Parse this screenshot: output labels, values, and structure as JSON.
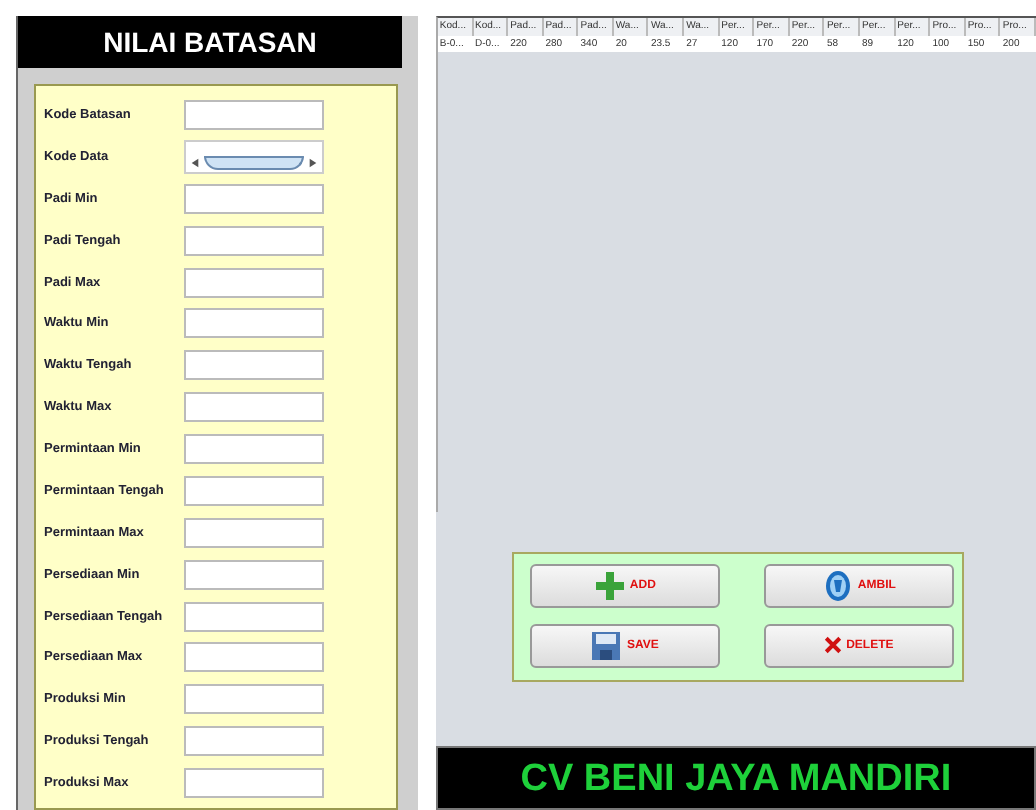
{
  "form": {
    "title": "NILAI BATASAN",
    "fields": [
      {
        "label": "Kode Batasan",
        "kind": "text"
      },
      {
        "label": "Kode Data",
        "kind": "scroll"
      },
      {
        "label": "Padi Min",
        "kind": "text"
      },
      {
        "label": "Padi Tengah",
        "kind": "text"
      },
      {
        "label": "Padi Max",
        "kind": "text"
      },
      {
        "label": "Waktu Min",
        "kind": "text"
      },
      {
        "label": "Waktu Tengah",
        "kind": "text"
      },
      {
        "label": "Waktu Max",
        "kind": "text"
      },
      {
        "label": "Permintaan Min",
        "kind": "text"
      },
      {
        "label": "Permintaan Tengah",
        "kind": "text"
      },
      {
        "label": "Permintaan Max",
        "kind": "text"
      },
      {
        "label": "Persediaan  Min",
        "kind": "text"
      },
      {
        "label": "Persediaan Tengah",
        "kind": "text"
      },
      {
        "label": "Persediaan Max",
        "kind": "text"
      },
      {
        "label": "Produksi Min",
        "kind": "text"
      },
      {
        "label": "Produksi Tengah",
        "kind": "text"
      },
      {
        "label": "Produksi Max",
        "kind": "text"
      }
    ]
  },
  "table": {
    "columns": [
      "Kod...",
      "Kod...",
      "Pad...",
      "Pad...",
      "Pad...",
      "Wa...",
      "Wa...",
      "Wa...",
      "Per...",
      "Per...",
      "Per...",
      "Per...",
      "Per...",
      "Per...",
      "Pro...",
      "Pro...",
      "Pro..."
    ],
    "rows": [
      [
        "B-0...",
        "D-0...",
        "220",
        "280",
        "340",
        "20",
        "23.5",
        "27",
        "120",
        "170",
        "220",
        "58",
        "89",
        "120",
        "100",
        "150",
        "200"
      ]
    ]
  },
  "buttons": [
    {
      "label": "ADD",
      "kind": "add"
    },
    {
      "label": "AMBIL",
      "kind": "ambil"
    },
    {
      "label": "SAVE",
      "kind": "save"
    },
    {
      "label": "DELETE",
      "kind": "delete"
    }
  ],
  "banner": "CV BENI JAYA MANDIRI"
}
